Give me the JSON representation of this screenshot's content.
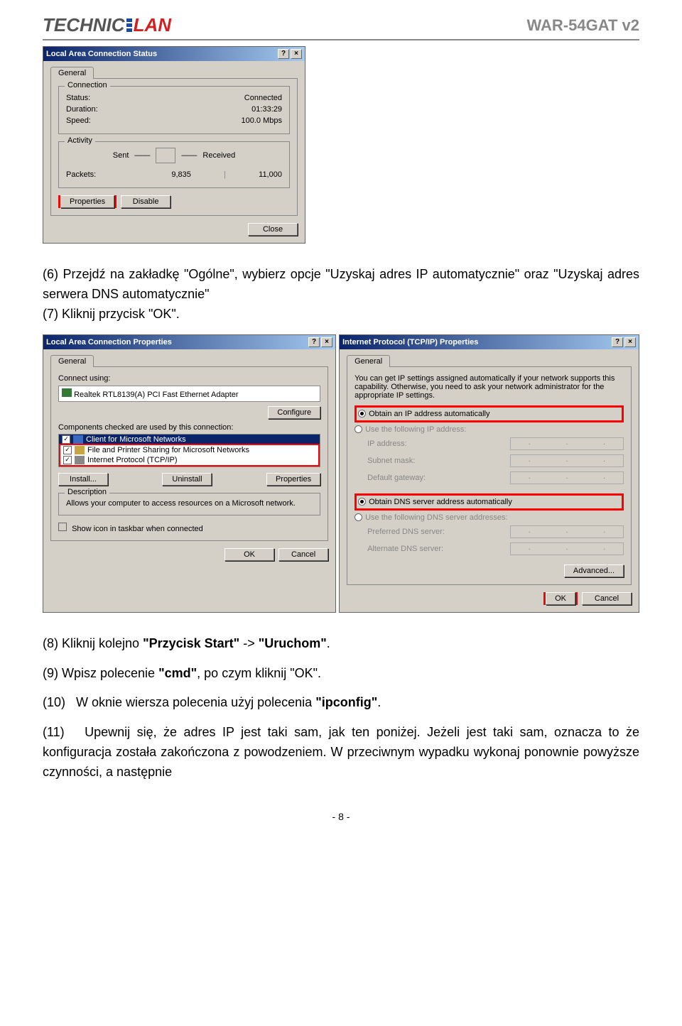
{
  "header": {
    "logo_left": "TECHNIC",
    "logo_right": "LAN",
    "model": "WAR-54GAT v2"
  },
  "dlg1": {
    "title": "Local Area Connection Status",
    "tab": "General",
    "connection_legend": "Connection",
    "status_lbl": "Status:",
    "status_val": "Connected",
    "duration_lbl": "Duration:",
    "duration_val": "01:33:29",
    "speed_lbl": "Speed:",
    "speed_val": "100.0 Mbps",
    "activity_legend": "Activity",
    "sent": "Sent",
    "received": "Received",
    "packets_lbl": "Packets:",
    "packets_sent": "9,835",
    "packets_recv": "11,000",
    "properties_btn": "Properties",
    "disable_btn": "Disable",
    "close_btn": "Close"
  },
  "dlg2": {
    "title": "Local Area Connection Properties",
    "tab": "General",
    "connect_lbl": "Connect using:",
    "adapter": "Realtek RTL8139(A) PCI Fast Ethernet Adapter",
    "configure_btn": "Configure",
    "components_lbl": "Components checked are used by this connection:",
    "item1": "Client for Microsoft Networks",
    "item2": "File and Printer Sharing for Microsoft Networks",
    "item3": "Internet Protocol (TCP/IP)",
    "install_btn": "Install...",
    "uninstall_btn": "Uninstall",
    "properties_btn": "Properties",
    "desc_legend": "Description",
    "desc_text": "Allows your computer to access resources on a Microsoft network.",
    "show_icon": "Show icon in taskbar when connected",
    "ok_btn": "OK",
    "cancel_btn": "Cancel"
  },
  "dlg3": {
    "title": "Internet Protocol (TCP/IP) Properties",
    "tab": "General",
    "info_text": "You can get IP settings assigned automatically if your network supports this capability. Otherwise, you need to ask your network administrator for the appropriate IP settings.",
    "obtain_ip": "Obtain an IP address automatically",
    "use_ip": "Use the following IP address:",
    "ip_lbl": "IP address:",
    "subnet_lbl": "Subnet mask:",
    "gw_lbl": "Default gateway:",
    "obtain_dns": "Obtain DNS server address automatically",
    "use_dns": "Use the following DNS server addresses:",
    "pref_dns": "Preferred DNS server:",
    "alt_dns": "Alternate DNS server:",
    "advanced_btn": "Advanced...",
    "ok_btn": "OK",
    "cancel_btn": "Cancel"
  },
  "instr": {
    "p6": "(6) Przejdź na zakładkę \"Ogólne\", wybierz opcje \"Uzyskaj adres IP automatycznie\" oraz \"Uzyskaj adres serwera DNS automatycznie\"",
    "p7": "(7) Kliknij przycisk \"OK\".",
    "p8": "(8) Kliknij kolejno \"Przycisk Start\" -> \"Uruchom\".",
    "p9": "(9) Wpisz polecenie \"cmd\", po czym kliknij \"OK\".",
    "p10": "(10)   W oknie wiersza polecenia użyj polecenia \"ipconfig\".",
    "p11": "(11)   Upewnij się, że adres IP jest taki sam, jak ten poniżej. Jeżeli jest taki sam, oznacza to że konfiguracja została zakończona z powodzeniem. W przeciwnym wypadku wykonaj ponownie powyższe czynności, a następnie"
  },
  "pagenum": "- 8 -"
}
